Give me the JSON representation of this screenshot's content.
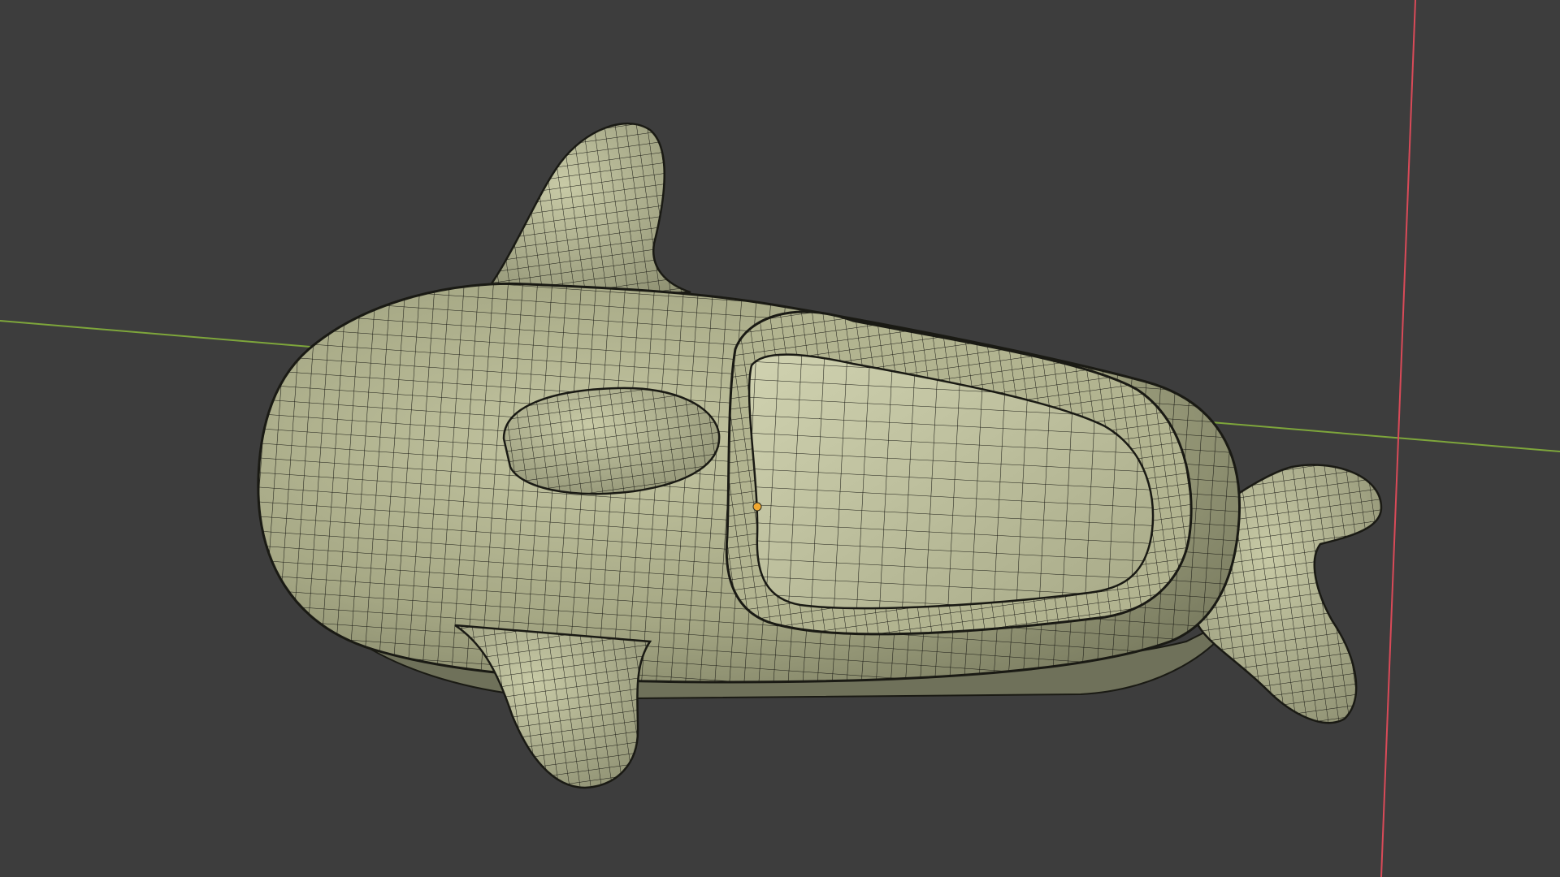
{
  "viewport": {
    "background": "#3d3d3d",
    "mode": "object",
    "wireframe_overlay": true
  },
  "axes": {
    "y_axis_color": "#7ea63b",
    "x_axis_color": "#d94a58"
  },
  "model": {
    "shape": "whale-like toy boat",
    "surface_color": "#a9ab88",
    "wire_color": "#1a1a14",
    "origin_color": "#f0a830",
    "parts": [
      "body",
      "cockpit",
      "rim",
      "dorsal-fin",
      "left-flipper",
      "right-flipper",
      "tail",
      "nose-bump"
    ]
  }
}
